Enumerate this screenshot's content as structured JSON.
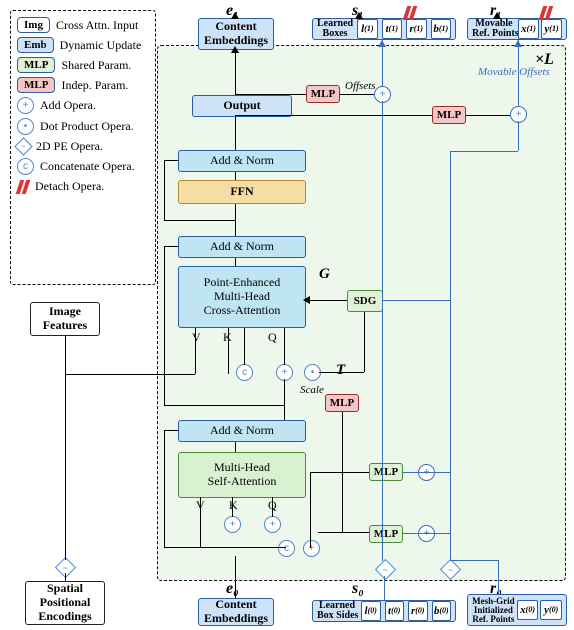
{
  "legend": {
    "img": "Img",
    "img_desc": "Cross Attn. Input",
    "emb": "Emb",
    "emb_desc": "Dynamic Update",
    "mlp_g": "MLP",
    "mlp_g_desc": "Shared Param.",
    "mlp_r": "MLP",
    "mlp_r_desc": "Indep. Param.",
    "add": "Add Opera.",
    "dot": "Dot Product Opera.",
    "pe": "2D PE Opera.",
    "cat": "Concatenate Opera.",
    "det": "Detach Opera."
  },
  "top": {
    "e1": "e₁",
    "s1": "s₁",
    "r1": "r₁",
    "content_emb": "Content\nEmbeddings",
    "learned_boxes": "Learned\nBoxes",
    "lb_cells": [
      "l",
      "t",
      "r",
      "b"
    ],
    "lb_sup": "(1)",
    "movable_ref": "Movable\nRef. Points",
    "mr_cells": [
      "x",
      "y"
    ],
    "mr_sup": "(1)",
    "xL": "×L",
    "offsets": "Offsets",
    "movable_offsets": "Movable\nOffsets"
  },
  "blocks": {
    "output": "Output",
    "addnorm": "Add & Norm",
    "ffn": "FFN",
    "pemhca": "Point-Enhanced\nMulti-Head\nCross-Attention",
    "mhsa": "Multi-Head\nSelf-Attention",
    "sdg": "SDG",
    "mlp": "MLP",
    "G": "G",
    "T": "T",
    "scale": "Scale",
    "V": "V",
    "K": "K",
    "Q": "Q"
  },
  "bottom": {
    "e0": "e₀",
    "s0": "s₀",
    "r0": "r₀",
    "content_emb": "Content\nEmbeddings",
    "learned_sides": "Learned\nBox Sides",
    "ls_cells": [
      "l",
      "t",
      "r",
      "b"
    ],
    "ls_sup": "(0)",
    "meshgrid": "Mesh-Grid\nInitialized\nRef. Points",
    "mg_cells": [
      "x",
      "y"
    ],
    "mg_sup": "(0)"
  },
  "left": {
    "image_features": "Image\nFeatures",
    "spatial_pe": "Spatial\nPositional\nEncodings"
  }
}
